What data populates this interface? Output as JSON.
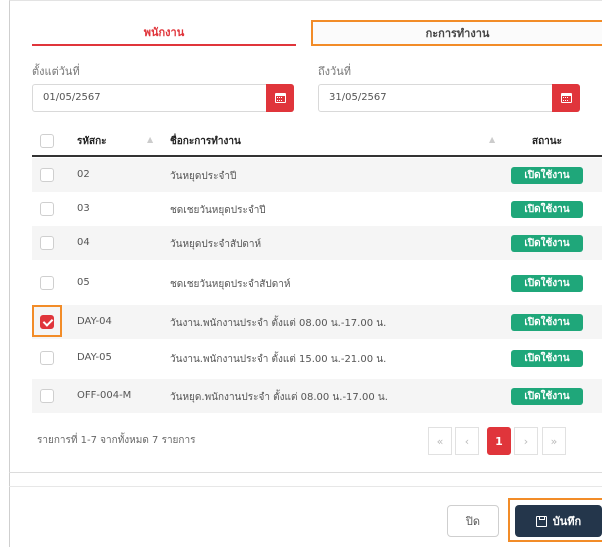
{
  "tabs": [
    {
      "label": "พนักงาน"
    },
    {
      "label": "กะการทำงาน"
    }
  ],
  "filters": {
    "from_label": "ตั้งแต่วันที่",
    "from_value": "01/05/2567",
    "to_label": "ถึงวันที่",
    "to_value": "31/05/2567"
  },
  "table": {
    "headers": {
      "code": "รหัสกะ",
      "name": "ชื่อกะการทำงาน",
      "status": "สถานะ"
    },
    "rows": [
      {
        "code": "02",
        "name": "วันหยุดประจำปี",
        "status": "เปิดใช้งาน",
        "checked": false
      },
      {
        "code": "03",
        "name": "ชดเชยวันหยุดประจำปี",
        "status": "เปิดใช้งาน",
        "checked": false
      },
      {
        "code": "04",
        "name": "วันหยุดประจำสัปดาห์",
        "status": "เปิดใช้งาน",
        "checked": false
      },
      {
        "code": "05",
        "name": "ชดเชยวันหยุดประจำสัปดาห์",
        "status": "เปิดใช้งาน",
        "checked": false
      },
      {
        "code": "DAY-04",
        "name": "วันงาน.พนักงานประจำ ตั้งแต่ 08.00 น.-17.00 น.",
        "status": "เปิดใช้งาน",
        "checked": true
      },
      {
        "code": "DAY-05",
        "name": "วันงาน.พนักงานประจำ ตั้งแต่ 15.00 น.-21.00 น.",
        "status": "เปิดใช้งาน",
        "checked": false
      },
      {
        "code": "OFF-004-M",
        "name": "วันหยุด.พนักงานประจำ ตั้งแต่ 08.00 น.-17.00 น.",
        "status": "เปิดใช้งาน",
        "checked": false
      }
    ]
  },
  "pagination": {
    "info": "รายการที่ 1-7 จากทั้งหมด 7 รายการ",
    "first": "«",
    "prev": "‹",
    "current": "1",
    "next": "›",
    "last": "»"
  },
  "buttons": {
    "close": "ปิด",
    "save": "บันทึก"
  },
  "colors": {
    "accent_red": "#e0353b",
    "status_green": "#1fa77a",
    "save_navy": "#24364b",
    "focus_orange": "#f28c28"
  }
}
